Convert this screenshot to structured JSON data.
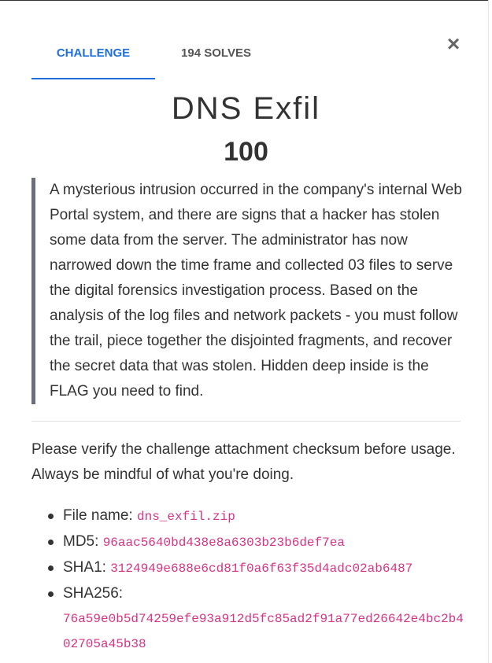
{
  "tabs": [
    {
      "label": "CHALLENGE"
    },
    {
      "label": "194 SOLVES"
    }
  ],
  "close_label": "×",
  "challenge": {
    "title": "DNS Exfil",
    "points": "100",
    "description": "A mysterious intrusion occurred in the company's internal Web Portal system, and there are signs that a hacker has stolen some data from the server. The administrator has now narrowed down the time frame and collected 03 files to serve the digital forensics investigation process. Based on the analysis of the log files and network packets - you must follow the trail, piece together the disjointed fragments, and recover the secret data that was stolen. Hidden deep inside is the FLAG you need to find."
  },
  "checksum_note": "Please verify the challenge attachment checksum before usage. Always be mindful of what you're doing.",
  "file_info": {
    "file_name_label": "File name:",
    "file_name": "dns_exfil.zip",
    "md5_label": "MD5:",
    "md5": "96aac5640bd438e8a6303b23b6def7ea",
    "sha1_label": "SHA1:",
    "sha1": "3124949e688e6cd81f0a6f63f35d4adc02ab6487",
    "sha256_label": "SHA256:",
    "sha256": "76a59e0b5d74259efe93a912d5fc85ad2f91a77ed26642e4bc2b402705a45b38"
  },
  "colors": {
    "accent": "#1e6fd9",
    "code": "#d63384",
    "quote_border": "#6b6f7a"
  }
}
